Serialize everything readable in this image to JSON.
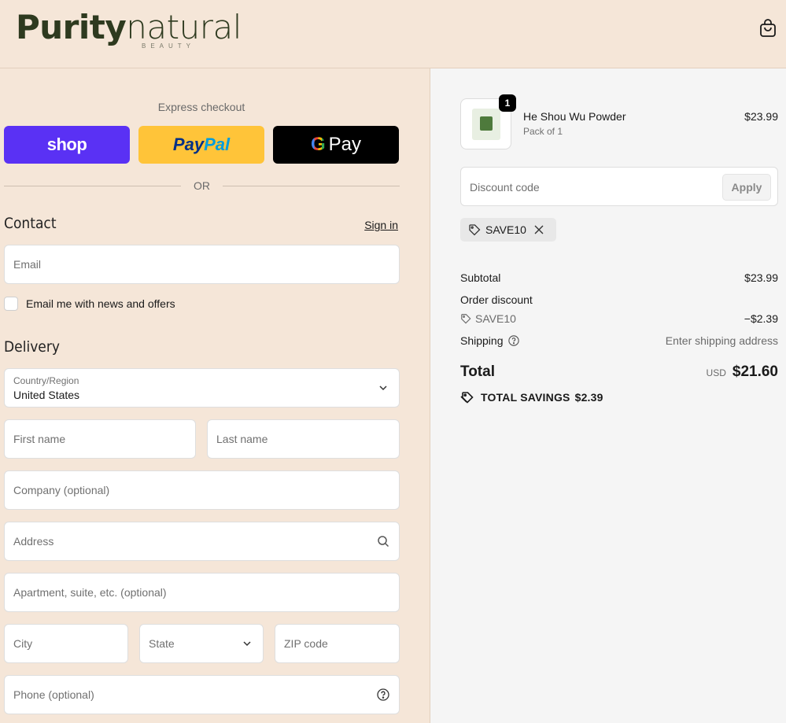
{
  "brand": {
    "name_bold": "Purity",
    "name_light": "natural",
    "sub": "BEAUTY"
  },
  "express": {
    "label": "Express checkout",
    "shop": "shop",
    "paypal_1": "Pay",
    "paypal_2": "Pal",
    "gpay_g": "G",
    "gpay_text": "Pay",
    "or": "OR"
  },
  "contact": {
    "title": "Contact",
    "signin": "Sign in",
    "email_placeholder": "Email",
    "newsletter": "Email me with news and offers"
  },
  "delivery": {
    "title": "Delivery",
    "country_label": "Country/Region",
    "country_value": "United States",
    "first_name": "First name",
    "last_name": "Last name",
    "company": "Company (optional)",
    "address": "Address",
    "apartment": "Apartment, suite, etc. (optional)",
    "city": "City",
    "state": "State",
    "zip": "ZIP code",
    "phone": "Phone (optional)"
  },
  "cart": {
    "qty": "1",
    "product_name": "He Shou Wu Powder",
    "variant": "Pack of 1",
    "price": "$23.99"
  },
  "discount": {
    "placeholder": "Discount code",
    "apply": "Apply",
    "applied_code": "SAVE10"
  },
  "summary": {
    "subtotal_label": "Subtotal",
    "subtotal_value": "$23.99",
    "order_discount_label": "Order discount",
    "discount_code": "SAVE10",
    "discount_value": "−$2.39",
    "shipping_label": "Shipping",
    "shipping_value": "Enter shipping address",
    "total_label": "Total",
    "currency": "USD",
    "total_value": "$21.60",
    "savings_label": "TOTAL SAVINGS",
    "savings_value": "$2.39"
  },
  "colors": {
    "background": "#f5e6d8",
    "shop_pay": "#5a31f4",
    "paypal": "#ffc439",
    "gpay": "#000000",
    "logo": "#2e3a1f"
  },
  "icons": [
    "bag-icon",
    "chevron-down-icon",
    "search-icon",
    "help-circle-icon",
    "tag-icon",
    "close-icon",
    "savings-tag-icon"
  ]
}
